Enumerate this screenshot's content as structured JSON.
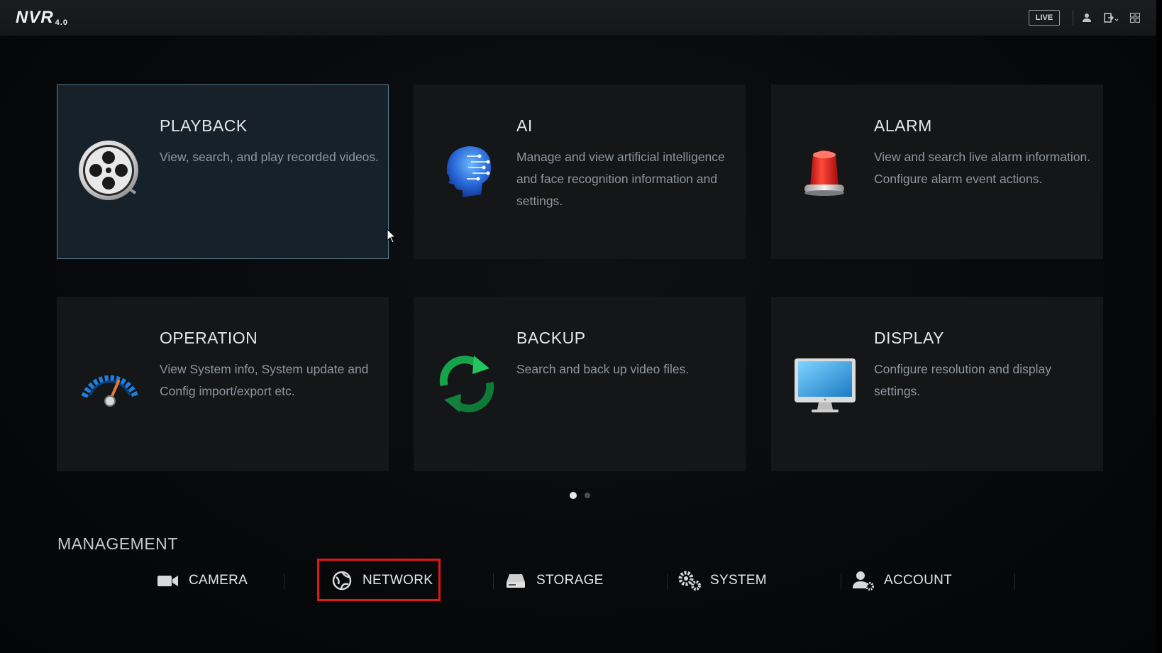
{
  "topbar": {
    "logo": "NVR",
    "logo_version": "4.0",
    "live_label": "LIVE",
    "icons": [
      "user-icon",
      "logout-icon",
      "grid-icon"
    ]
  },
  "cards": [
    {
      "title": "PLAYBACK",
      "description": "View, search, and play recorded videos.",
      "icon": "film-reel-icon",
      "selected": true
    },
    {
      "title": "AI",
      "description": "Manage and view artificial intelligence and face recognition information and settings.",
      "icon": "ai-head-icon"
    },
    {
      "title": "ALARM",
      "description": "View and search live alarm information. Configure alarm event actions.",
      "icon": "alarm-light-icon"
    },
    {
      "title": "OPERATION",
      "description": "View System info, System update and Config import/export etc.",
      "icon": "gauge-icon"
    },
    {
      "title": "BACKUP",
      "description": "Search and back up video files.",
      "icon": "backup-arrows-icon"
    },
    {
      "title": "DISPLAY",
      "description": "Configure resolution and display settings.",
      "icon": "monitor-icon"
    }
  ],
  "pager": {
    "pages": 2,
    "current": 1
  },
  "management": {
    "title": "MANAGEMENT",
    "items": [
      {
        "label": "CAMERA",
        "icon": "camera-icon"
      },
      {
        "label": "NETWORK",
        "icon": "network-globe-icon",
        "highlighted": true
      },
      {
        "label": "STORAGE",
        "icon": "storage-drive-icon"
      },
      {
        "label": "SYSTEM",
        "icon": "gears-icon"
      },
      {
        "label": "ACCOUNT",
        "icon": "account-icon"
      }
    ]
  },
  "colors": {
    "selected_border": "#5e7d92",
    "highlight": "#e01818",
    "card_bg": "#141618"
  }
}
